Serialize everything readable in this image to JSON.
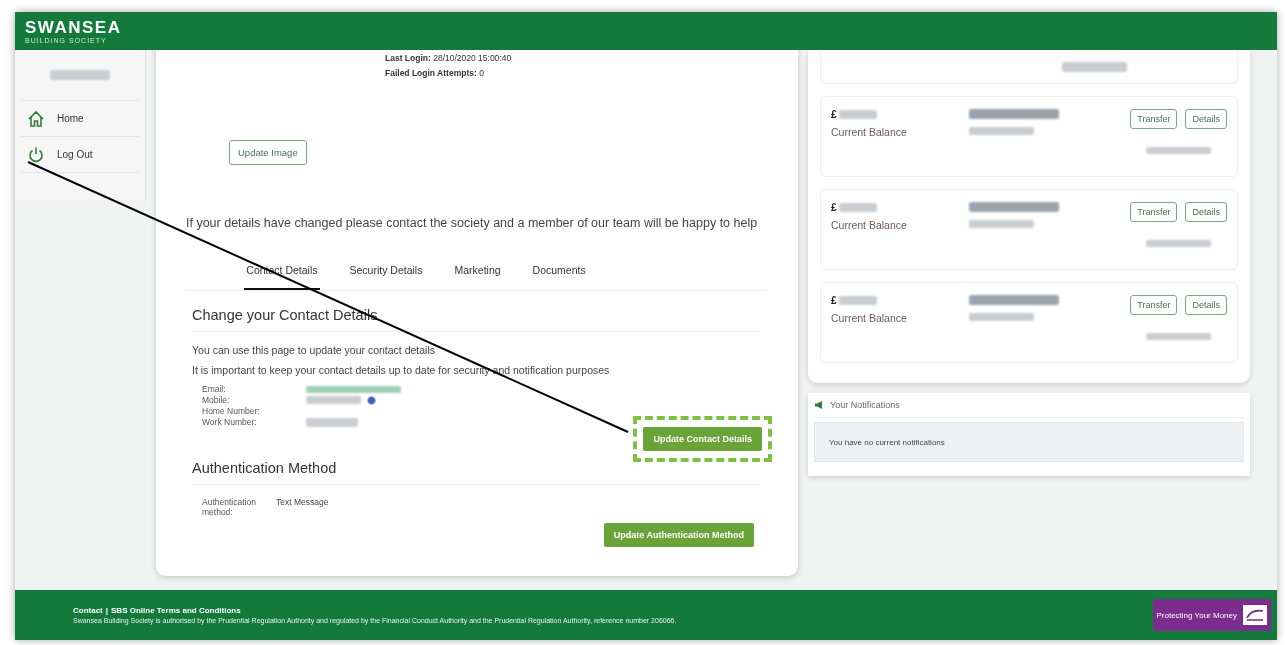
{
  "header": {
    "logo_title": "SWANSEA",
    "logo_subtitle": "BUILDING SOCIETY"
  },
  "sidebar": {
    "items": [
      {
        "label": "Home",
        "kind": "home"
      },
      {
        "label": "Log Out",
        "kind": "logout"
      }
    ]
  },
  "login_info": [
    "**Last Login:** 28/10/2020 15:00:40",
    "**Failed Login Attempts:** 0"
  ],
  "update_image_button": "Update Image",
  "notice": "If your details have changed please contact the society and a member of our team will be happy to help",
  "tabs": [
    {
      "label": "Contact Details",
      "selected": true
    },
    {
      "label": "Security Details",
      "selected": false
    },
    {
      "label": "Marketing",
      "selected": false
    },
    {
      "label": "Documents",
      "selected": false
    }
  ],
  "contact_section": {
    "heading": "Change your Contact Details",
    "paragraphs": [
      "You can use this page to update your contact details",
      "It is important to keep your contact details up to date for security and notification purposes"
    ],
    "fields": [
      {
        "label": "Email:",
        "kind": "email"
      },
      {
        "label": "Mobile:",
        "kind": "verified"
      },
      {
        "label": "Home Number:",
        "kind": "empty"
      },
      {
        "label": "Work Number:",
        "kind": "phone"
      }
    ],
    "button": "Update Contact Details"
  },
  "auth_section": {
    "heading": "Authentication Method",
    "label": "Authentication method:",
    "value": "Text Message",
    "button": "Update Authentication Method"
  },
  "accounts": [
    {
      "kind": "partial"
    },
    {
      "kind": "full",
      "currency": "£",
      "balance_label": "Current Balance",
      "buttons": [
        "Transfer",
        "Details"
      ]
    },
    {
      "kind": "full",
      "currency": "£",
      "balance_label": "Current Balance",
      "buttons": [
        "Transfer",
        "Details"
      ]
    },
    {
      "kind": "full",
      "currency": "£",
      "balance_label": "Current Balance",
      "buttons": [
        "Transfer",
        "Details"
      ]
    }
  ],
  "notifications": {
    "title": "Your Notifications",
    "message": "You have no current notifications"
  },
  "footer": {
    "links": [
      "Contact",
      "SBS Online Terms and Conditions"
    ],
    "separator": "|",
    "legal": "Swansea Building Society is authorised by the Prudential Regulation Authority and regulated by the Financial Conduct Authority and the Prudential Regulation Authority, reference number 206066.",
    "badge": "Protecting Your Money"
  }
}
